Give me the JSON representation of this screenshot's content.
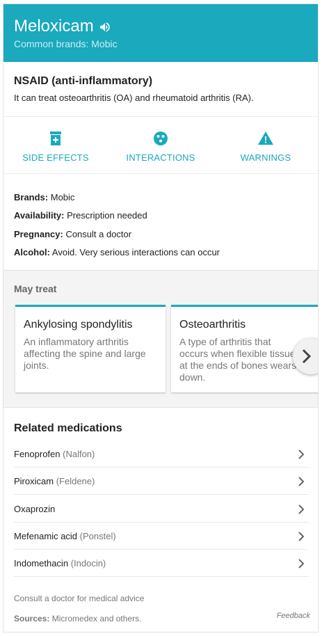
{
  "header": {
    "title": "Meloxicam",
    "speaker_icon": "speaker-icon",
    "common_brands": "Common brands: Mobic"
  },
  "drug_class": {
    "name": "NSAID (anti-inflammatory)",
    "description": "It can treat osteoarthritis (OA) and rheumatoid arthritis (RA)."
  },
  "tabs": [
    {
      "label": "SIDE EFFECTS",
      "icon": "medication-icon"
    },
    {
      "label": "INTERACTIONS",
      "icon": "interactions-icon"
    },
    {
      "label": "WARNINGS",
      "icon": "warning-icon"
    }
  ],
  "facts": [
    {
      "key": "Brands:",
      "value": "Mobic"
    },
    {
      "key": "Availability:",
      "value": "Prescription needed"
    },
    {
      "key": "Pregnancy:",
      "value": "Consult a doctor"
    },
    {
      "key": "Alcohol:",
      "value": "Avoid. Very serious interactions can occur"
    }
  ],
  "may_treat": {
    "title": "May treat",
    "conditions": [
      {
        "name": "Ankylosing spondylitis",
        "description": "An inflammatory arthritis affecting the spine and large joints."
      },
      {
        "name": "Osteoarthritis",
        "description": "A type of arthritis that occurs when flexible tissue at the ends of bones wears down."
      }
    ]
  },
  "related": {
    "title": "Related medications",
    "items": [
      {
        "name": "Fenoprofen",
        "brand": "(Nalfon)"
      },
      {
        "name": "Piroxicam",
        "brand": "(Feldene)"
      },
      {
        "name": "Oxaprozin",
        "brand": ""
      },
      {
        "name": "Mefenamic acid",
        "brand": "(Ponstel)"
      },
      {
        "name": "Indomethacin",
        "brand": "(Indocin)"
      }
    ]
  },
  "footer": {
    "note": "Consult a doctor for medical advice",
    "sources_label": "Sources:",
    "sources_value": "Micromedex and others.",
    "feedback": "Feedback"
  },
  "colors": {
    "accent": "#1aa9bd",
    "muted_text": "#777777"
  }
}
